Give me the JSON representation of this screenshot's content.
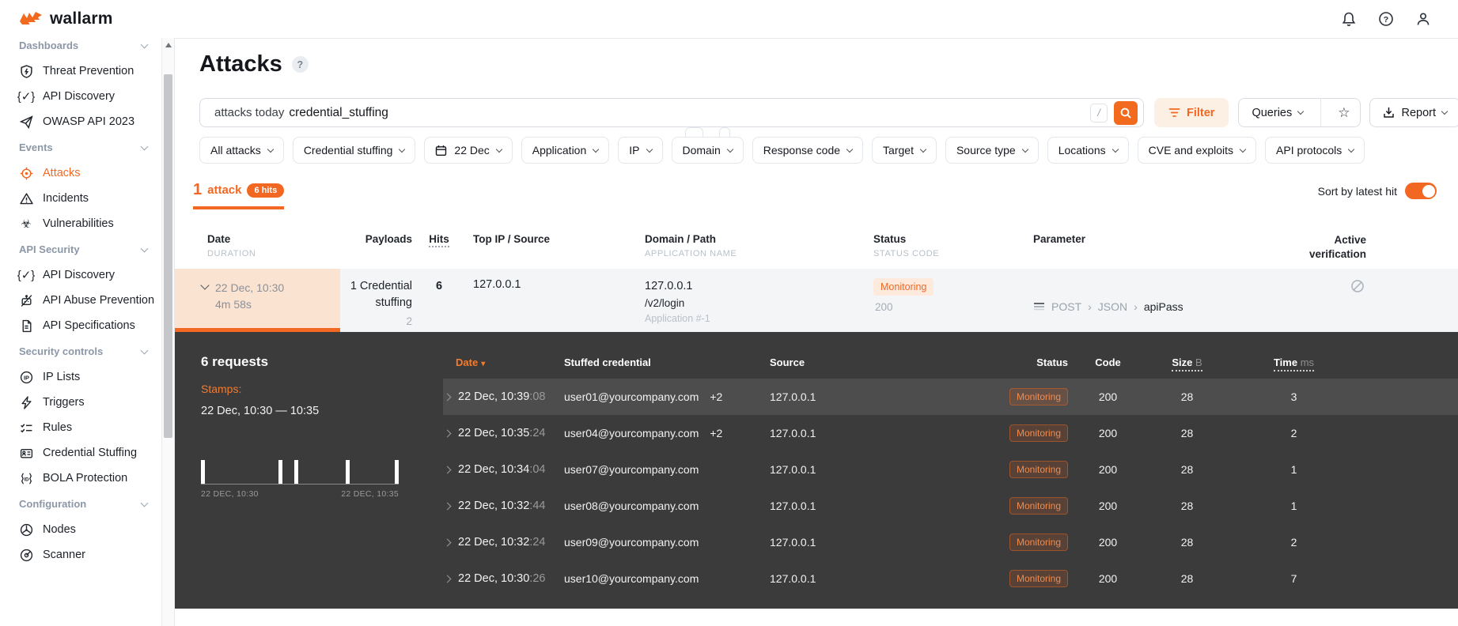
{
  "colors": {
    "accent": "#f26822",
    "panel_dark": "#3b3b3c",
    "row_highlight": "#4d4d4e",
    "date_cell_bg": "#fbe3d1",
    "badge_light_bg": "#fdeadc"
  },
  "topbar": {
    "brand": "wallarm",
    "icons": [
      "bell-icon",
      "help-icon",
      "user-icon"
    ]
  },
  "sidebar": {
    "groups": [
      {
        "header": "Dashboards",
        "items": [
          {
            "label": "Threat Prevention",
            "icon": "shield-bolt-icon"
          },
          {
            "label": "API Discovery",
            "icon": "braces-check-icon"
          },
          {
            "label": "OWASP API 2023",
            "icon": "paper-plane-icon"
          }
        ]
      },
      {
        "header": "Events",
        "items": [
          {
            "label": "Attacks",
            "icon": "target-icon",
            "active": true
          },
          {
            "label": "Incidents",
            "icon": "warning-triangle-icon"
          },
          {
            "label": "Vulnerabilities",
            "icon": "biohazard-icon"
          }
        ]
      },
      {
        "header": "API Security",
        "items": [
          {
            "label": "API Discovery",
            "icon": "braces-check-icon"
          },
          {
            "label": "API Abuse Prevention",
            "icon": "robot-slash-icon"
          },
          {
            "label": "API Specifications",
            "icon": "document-icon"
          }
        ]
      },
      {
        "header": "Security controls",
        "items": [
          {
            "label": "IP Lists",
            "icon": "ip-circle-icon"
          },
          {
            "label": "Triggers",
            "icon": "lightning-icon"
          },
          {
            "label": "Rules",
            "icon": "checklist-icon"
          },
          {
            "label": "Credential Stuffing",
            "icon": "id-card-icon"
          },
          {
            "label": "BOLA Protection",
            "icon": "braces-id-icon"
          }
        ]
      },
      {
        "header": "Configuration",
        "items": [
          {
            "label": "Nodes",
            "icon": "node-circle-icon"
          },
          {
            "label": "Scanner",
            "icon": "radar-icon"
          }
        ]
      }
    ]
  },
  "page": {
    "title": "Attacks"
  },
  "search": {
    "query_keywords": "attacks today",
    "query_term": "credential_stuffing",
    "shortcut_hint": "/"
  },
  "toolbar": {
    "filter_label": "Filter",
    "queries_label": "Queries",
    "report_label": "Report"
  },
  "filters": {
    "chips": [
      "All attacks",
      "Credential stuffing",
      "22 Dec",
      "Application",
      "IP",
      "Domain",
      "Response code",
      "Target",
      "Source type",
      "Locations",
      "CVE and exploits",
      "API protocols"
    ]
  },
  "summary_tab": {
    "count": "1",
    "label": "attack",
    "hits_badge": "6 hits"
  },
  "sort": {
    "label": "Sort by latest hit",
    "enabled": true
  },
  "attacks_table": {
    "headers": {
      "date": "Date",
      "date_sub": "DURATION",
      "payloads": "Payloads",
      "hits": "Hits",
      "top_ip": "Top IP / Source",
      "domain": "Domain / Path",
      "domain_sub": "APPLICATION NAME",
      "status": "Status",
      "status_sub": "STATUS CODE",
      "parameter": "Parameter",
      "active_verification": "Active verification"
    },
    "row": {
      "date": "22 Dec, 10:30",
      "duration": "4m 58s",
      "payloads": "1 Credential stuffing",
      "payloads_sub": "2",
      "hits": "6",
      "top_ip": "127.0.0.1",
      "domain": "127.0.0.1",
      "path": "/v2/login",
      "application": "Application #-1",
      "status": "Monitoring",
      "status_code": "200",
      "param_method": "POST",
      "param_sep1": "›",
      "param_format": "JSON",
      "param_sep2": "›",
      "param_name": "apiPass"
    }
  },
  "requests_panel": {
    "title": "6 requests",
    "stamps_label": "Stamps:",
    "stamps_range": "22 Dec, 10:30 — 10:35",
    "chart": {
      "type": "bar",
      "description": "request hits over time",
      "x_labels": [
        "22 DEC, 10:30",
        "22 DEC, 10:35"
      ],
      "bars_pct": [
        0,
        39,
        47,
        73,
        98
      ],
      "bar_heights": [
        1,
        1,
        1,
        1,
        1
      ]
    },
    "headers": {
      "date": "Date",
      "sort_arrow": "▾",
      "credential": "Stuffed credential",
      "source": "Source",
      "status": "Status",
      "code": "Code",
      "size": "Size",
      "size_unit": "B",
      "time": "Time",
      "time_unit": "ms"
    },
    "rows": [
      {
        "date": "22 Dec, 10:39",
        "seconds": ":08",
        "credential": "user01@yourcompany.com",
        "extra": "+2",
        "source": "127.0.0.1",
        "status": "Monitoring",
        "code": "200",
        "size": "28",
        "time": "3",
        "highlighted": true
      },
      {
        "date": "22 Dec, 10:35",
        "seconds": ":24",
        "credential": "user04@yourcompany.com",
        "extra": "+2",
        "source": "127.0.0.1",
        "status": "Monitoring",
        "code": "200",
        "size": "28",
        "time": "2",
        "highlighted": false
      },
      {
        "date": "22 Dec, 10:34",
        "seconds": ":04",
        "credential": "user07@yourcompany.com",
        "extra": "",
        "source": "127.0.0.1",
        "status": "Monitoring",
        "code": "200",
        "size": "28",
        "time": "1",
        "highlighted": false
      },
      {
        "date": "22 Dec, 10:32",
        "seconds": ":44",
        "credential": "user08@yourcompany.com",
        "extra": "",
        "source": "127.0.0.1",
        "status": "Monitoring",
        "code": "200",
        "size": "28",
        "time": "1",
        "highlighted": false
      },
      {
        "date": "22 Dec, 10:32",
        "seconds": ":24",
        "credential": "user09@yourcompany.com",
        "extra": "",
        "source": "127.0.0.1",
        "status": "Monitoring",
        "code": "200",
        "size": "28",
        "time": "2",
        "highlighted": false
      },
      {
        "date": "22 Dec, 10:30",
        "seconds": ":26",
        "credential": "user10@yourcompany.com",
        "extra": "",
        "source": "127.0.0.1",
        "status": "Monitoring",
        "code": "200",
        "size": "28",
        "time": "7",
        "highlighted": false
      }
    ]
  }
}
